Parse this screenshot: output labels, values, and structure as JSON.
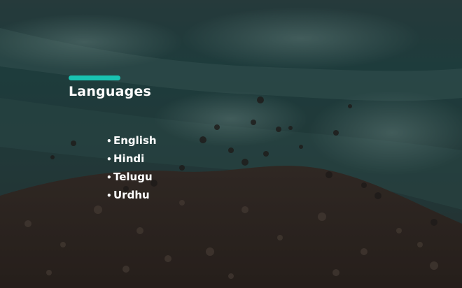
{
  "slide": {
    "title": "Languages",
    "accent_color": "#19c3b2",
    "background": "aerial-beach-photo",
    "languages": [
      {
        "bullet": "•",
        "label": "English"
      },
      {
        "bullet": "•",
        "label": "Hindi"
      },
      {
        "bullet": "•",
        "label": "Telugu"
      },
      {
        "bullet": "•",
        "label": "Urdhu"
      }
    ]
  }
}
